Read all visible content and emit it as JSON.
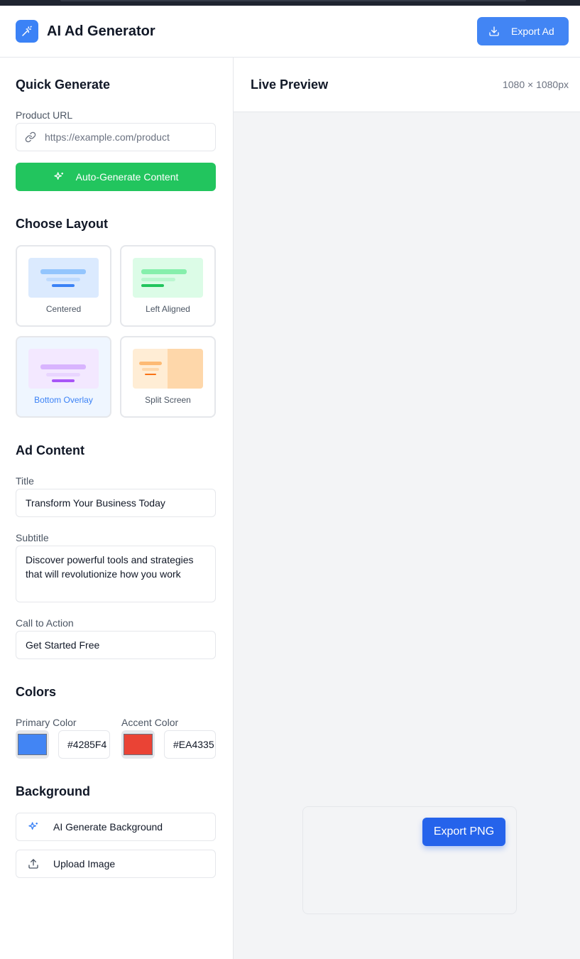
{
  "header": {
    "app_title": "AI Ad Generator",
    "export_label": "Export Ad"
  },
  "quick_generate": {
    "title": "Quick Generate",
    "url_label": "Product URL",
    "url_placeholder": "https://example.com/product",
    "generate_label": "Auto-Generate Content"
  },
  "layout": {
    "title": "Choose Layout",
    "options": [
      {
        "label": "Centered"
      },
      {
        "label": "Left Aligned"
      },
      {
        "label": "Bottom Overlay"
      },
      {
        "label": "Split Screen"
      }
    ],
    "selected": "Bottom Overlay"
  },
  "content": {
    "title": "Ad Content",
    "title_label": "Title",
    "title_value": "Transform Your Business Today",
    "subtitle_label": "Subtitle",
    "subtitle_value": "Discover powerful tools and strategies that will revolutionize how you work",
    "cta_label": "Call to Action",
    "cta_value": "Get Started Free"
  },
  "colors": {
    "title": "Colors",
    "primary_label": "Primary Color",
    "primary_value": "#4285F4",
    "accent_label": "Accent Color",
    "accent_value": "#EA4335"
  },
  "background": {
    "title": "Background",
    "ai_label": "AI Generate Background",
    "upload_label": "Upload Image"
  },
  "preview": {
    "title": "Live Preview",
    "size": "1080 × 1080px",
    "export_label": "Export PNG"
  }
}
